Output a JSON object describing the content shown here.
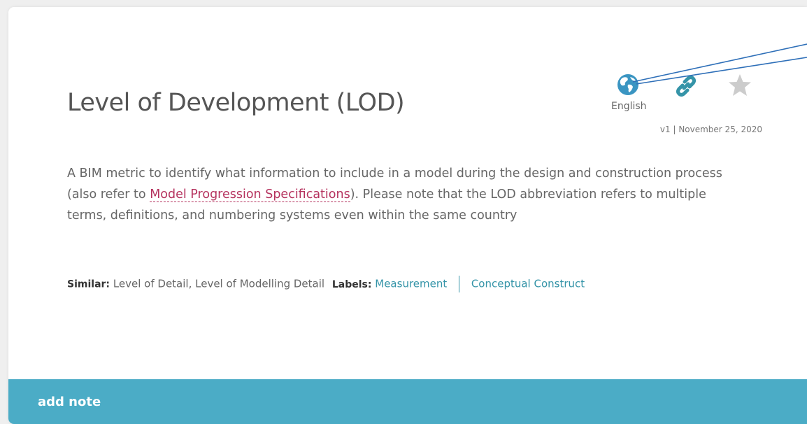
{
  "term": {
    "title": "Level of Development (LOD)",
    "language": "English",
    "version": "v1 | November 25, 2020",
    "definition": {
      "before_link": "A BIM metric to identify what information to include in a model during the design and construction process (also refer to ",
      "link_text": "Model Progression Specifications",
      "after_link": "). Please note that the LOD abbreviation refers to multiple terms, definitions, and numbering systems even within the same country"
    },
    "similar_key": "Similar:",
    "similar_value": "Level of Detail, Level of Modelling Detail",
    "labels_key": "Labels:",
    "labels": [
      "Measurement",
      "Conceptual Construct"
    ]
  },
  "footer": {
    "add_note_label": "add note"
  },
  "icons": {
    "language": "globe-icon",
    "share": "link-icon",
    "favorite": "star-icon"
  },
  "colors": {
    "accent": "#4bacc6",
    "link_teal": "#3594a8",
    "term_link": "#b5325e",
    "star_gray": "#cccccc"
  }
}
